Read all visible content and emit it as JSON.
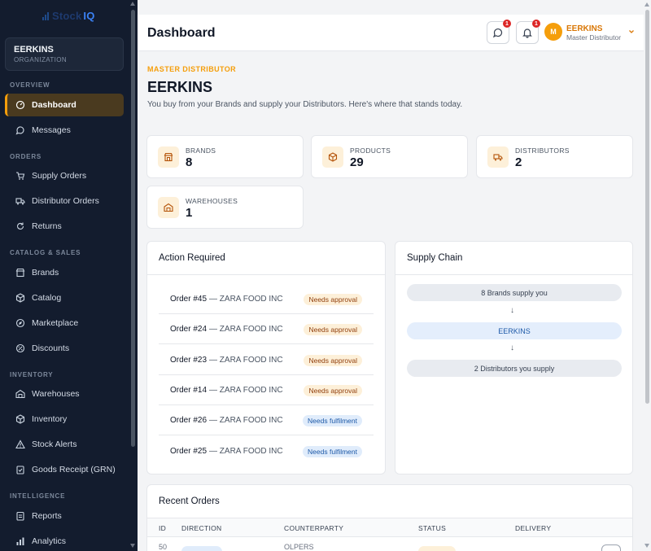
{
  "brand": {
    "logo_part1": "Stock",
    "logo_part2": "IQ"
  },
  "sidebar": {
    "org_name": "EERKINS",
    "org_label": "ORGANIZATION",
    "sections": {
      "overview": "OVERVIEW",
      "orders": "ORDERS",
      "catalog": "CATALOG & SALES",
      "inventory": "INVENTORY",
      "intelligence": "INTELLIGENCE"
    },
    "items": {
      "dashboard": "Dashboard",
      "messages": "Messages",
      "supply_orders": "Supply Orders",
      "distributor_orders": "Distributor Orders",
      "returns": "Returns",
      "brands": "Brands",
      "catalog": "Catalog",
      "marketplace": "Marketplace",
      "discounts": "Discounts",
      "warehouses": "Warehouses",
      "inventory": "Inventory",
      "stock_alerts": "Stock Alerts",
      "goods_receipt": "Goods Receipt (GRN)",
      "reports": "Reports",
      "analytics": "Analytics"
    },
    "active_item": "dashboard",
    "accent_color": "#f59e0b"
  },
  "header": {
    "title": "Dashboard",
    "messages_badge": "1",
    "notifications_badge": "1",
    "avatar_initial": "M",
    "user_name": "EERKINS",
    "user_role": "Master Distributor"
  },
  "page": {
    "kicker": "MASTER DISTRIBUTOR",
    "title": "EERKINS",
    "subtitle": "You buy from your Brands and supply your Distributors. Here's where that stands today."
  },
  "stats": {
    "brands": {
      "label": "BRANDS",
      "value": "8",
      "icon": "store-icon"
    },
    "products": {
      "label": "PRODUCTS",
      "value": "29",
      "icon": "box-icon"
    },
    "distributors": {
      "label": "DISTRIBUTORS",
      "value": "2",
      "icon": "truck-icon"
    },
    "warehouses": {
      "label": "WAREHOUSES",
      "value": "1",
      "icon": "warehouse-icon"
    }
  },
  "action_required": {
    "title": "Action Required",
    "rows": [
      {
        "order": "Order #45",
        "party": "— ZARA FOOD INC",
        "status": "Needs approval",
        "kind": "approval"
      },
      {
        "order": "Order #24",
        "party": "— ZARA FOOD INC",
        "status": "Needs approval",
        "kind": "approval"
      },
      {
        "order": "Order #23",
        "party": "— ZARA FOOD INC",
        "status": "Needs approval",
        "kind": "approval"
      },
      {
        "order": "Order #14",
        "party": "— ZARA FOOD INC",
        "status": "Needs approval",
        "kind": "approval"
      },
      {
        "order": "Order #26",
        "party": "— ZARA FOOD INC",
        "status": "Needs fulfilment",
        "kind": "fulfil"
      },
      {
        "order": "Order #25",
        "party": "— ZARA FOOD INC",
        "status": "Needs fulfilment",
        "kind": "fulfil"
      }
    ]
  },
  "supply_chain": {
    "title": "Supply Chain",
    "upstream": "8 Brands supply you",
    "arrow": "↓",
    "self": "EERKINS",
    "downstream": "2 Distributors you supply"
  },
  "recent_orders": {
    "title": "Recent Orders",
    "columns": [
      "ID",
      "DIRECTION",
      "COUNTERPARTY",
      "STATUS",
      "DELIVERY"
    ],
    "partial_row": {
      "id": "50",
      "counterparty": "OLPERS"
    }
  }
}
